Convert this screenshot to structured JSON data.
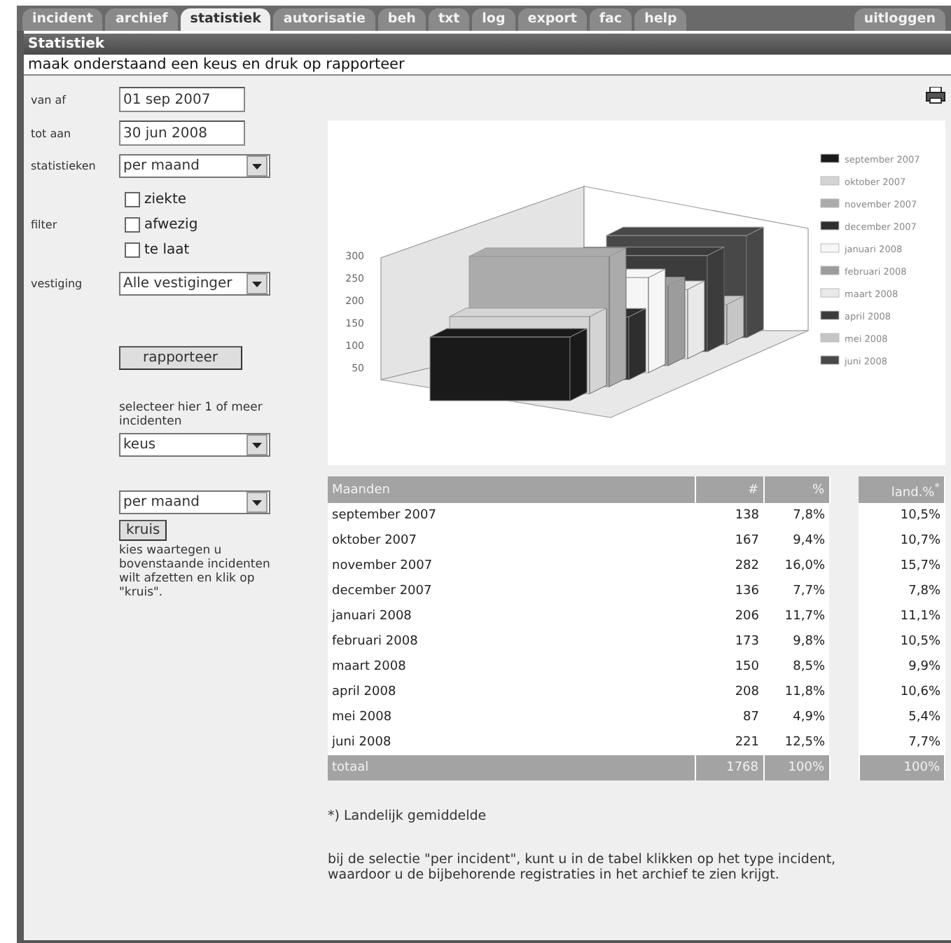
{
  "tabs": [
    {
      "label": "incident",
      "selected": false
    },
    {
      "label": "archief",
      "selected": false
    },
    {
      "label": "statistiek",
      "selected": true
    },
    {
      "label": "autorisatie",
      "selected": false
    },
    {
      "label": "beh",
      "selected": false
    },
    {
      "label": "txt",
      "selected": false
    },
    {
      "label": "log",
      "selected": false
    },
    {
      "label": "export",
      "selected": false
    },
    {
      "label": "fac",
      "selected": false
    },
    {
      "label": "help",
      "selected": false
    }
  ],
  "logout": "uitloggen",
  "page_title": "Statistiek",
  "instruction": "maak onderstaand een keus en druk op rapporteer",
  "form": {
    "from": {
      "label": "van af",
      "value": "01 sep 2007"
    },
    "to": {
      "label": "tot aan",
      "value": "30 jun 2008"
    },
    "statistics": {
      "label": "statistieken",
      "value": "per maand"
    },
    "filter": {
      "label": "filter",
      "options": [
        {
          "label": "ziekte",
          "checked": false
        },
        {
          "label": "afwezig",
          "checked": false
        },
        {
          "label": "te laat",
          "checked": false
        }
      ]
    },
    "branch": {
      "label": "vestiging",
      "value": "Alle vestiginger"
    },
    "report_button": "rapporteer",
    "incidents_hint": "selecteer hier 1 of meer incidenten",
    "incidents_select": "keus",
    "cross_select": "per maand",
    "cross_button": "kruis",
    "cross_hint": "kies waartegen u bovenstaande incidenten wilt afzetten en klik op \"kruis\"."
  },
  "chart": {
    "kind": "picture",
    "ticks": [
      "300",
      "250",
      "200",
      "150",
      "100",
      "50"
    ],
    "legend": [
      {
        "label": "september 2007",
        "color": "#1a1a1a"
      },
      {
        "label": "oktober 2007",
        "color": "#d4d4d4"
      },
      {
        "label": "november 2007",
        "color": "#ababab"
      },
      {
        "label": "december 2007",
        "color": "#2e2e2e"
      },
      {
        "label": "januari 2008",
        "color": "#f6f6f6"
      },
      {
        "label": "februari 2008",
        "color": "#9c9c9c"
      },
      {
        "label": "maart 2008",
        "color": "#e9e9e9"
      },
      {
        "label": "april 2008",
        "color": "#3c3c3c"
      },
      {
        "label": "mei 2008",
        "color": "#c6c6c6"
      },
      {
        "label": "juni 2008",
        "color": "#484848"
      }
    ]
  },
  "table": {
    "columns": [
      "Maanden",
      "#",
      "%",
      "land.%$^{*}$"
    ],
    "rows": [
      [
        "september 2007",
        "138",
        "7,8%",
        "10,5%"
      ],
      [
        "oktober 2007",
        "167",
        "9,4%",
        "10,7%"
      ],
      [
        "november 2007",
        "282",
        "16,0%",
        "15,7%"
      ],
      [
        "december 2007",
        "136",
        "7,7%",
        "7,8%"
      ],
      [
        "januari 2008",
        "206",
        "11,7%",
        "11,1%"
      ],
      [
        "februari 2008",
        "173",
        "9,8%",
        "10,5%"
      ],
      [
        "maart 2008",
        "150",
        "8,5%",
        "9,9%"
      ],
      [
        "april 2008",
        "208",
        "11,8%",
        "10,6%"
      ],
      [
        "mei 2008",
        "87",
        "4,9%",
        "5,4%"
      ],
      [
        "juni 2008",
        "221",
        "12,5%",
        "7,7%"
      ]
    ],
    "total": [
      "totaal",
      "1768",
      "100%",
      "100%"
    ]
  },
  "footnote": "*) Landelijk gemiddelde",
  "note": "bij de selectie \"per incident\", kunt u in de tabel klikken op het type incident, waardoor u de bijbehorende registraties in het archief te zien krijgt."
}
